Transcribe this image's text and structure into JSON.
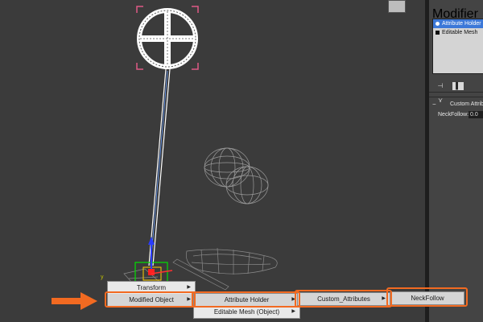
{
  "viewport": {
    "axis_label": "y",
    "tag_icon": "viewcube-icon"
  },
  "panel": {
    "header": "Modifier List",
    "stack": [
      {
        "label": "Attribute Holder",
        "selected": true
      },
      {
        "label": "Editable Mesh",
        "selected": false
      }
    ],
    "tools": [
      "pin-stack-icon",
      "show-end-result-icon",
      "configure-modifier-sets-icon"
    ],
    "rollout_title": "Custom Attributes",
    "param_label": "NeckFollow:",
    "param_value": "0.0"
  },
  "context_menu": {
    "level1": [
      {
        "label": "Transform",
        "has_submenu": true
      },
      {
        "label": "Modified Object",
        "has_submenu": true,
        "highlighted": true
      }
    ],
    "level2": [
      {
        "label": "Attribute Holder",
        "has_submenu": true,
        "highlighted": true
      },
      {
        "label": "Editable Mesh (Object)",
        "has_submenu": true
      }
    ],
    "level3": [
      {
        "label": "Custom_Attributes",
        "has_submenu": true,
        "highlighted": true
      }
    ],
    "level4": [
      {
        "label": "NeckFollow"
      }
    ]
  },
  "colors": {
    "callout": "#f26a21",
    "selection": "#3c78d8",
    "viewport_bg": "#3b3b3b"
  }
}
